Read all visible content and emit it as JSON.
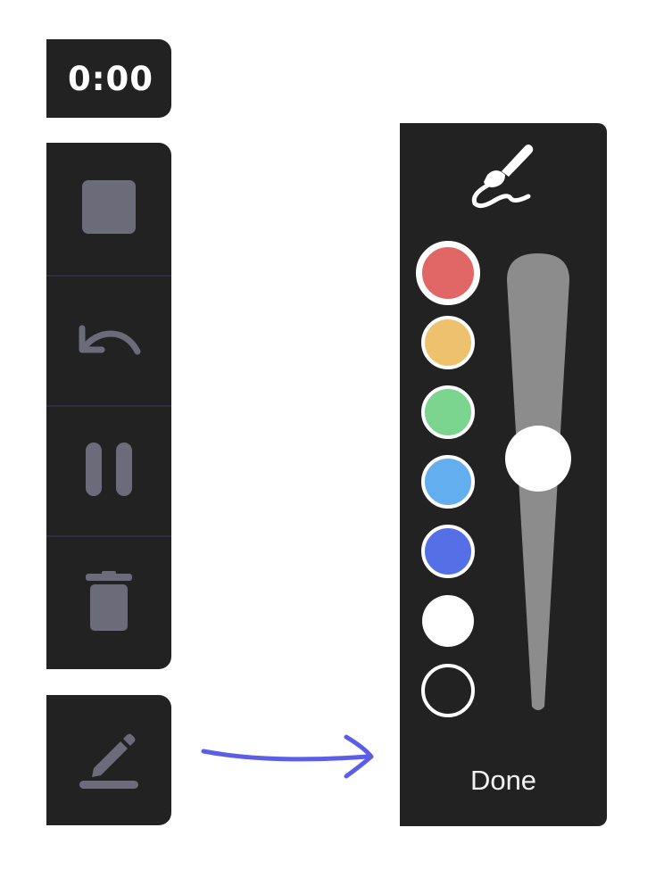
{
  "timer": {
    "value": "0:00"
  },
  "controls": {
    "stop_icon": "stop-square-icon",
    "undo_icon": "undo-arrow-icon",
    "pause_icon": "pause-icon",
    "delete_icon": "trash-icon"
  },
  "pen": {
    "icon": "pen-draw-icon"
  },
  "palette": {
    "brush_icon": "brush-squiggle-icon",
    "swatches": [
      {
        "name": "red",
        "color": "#e06766",
        "selected": true
      },
      {
        "name": "orange",
        "color": "#eec26d"
      },
      {
        "name": "green",
        "color": "#7cd58e"
      },
      {
        "name": "light-blue",
        "color": "#62aeef"
      },
      {
        "name": "blue",
        "color": "#5570e6"
      },
      {
        "name": "white",
        "color": "#ffffff"
      },
      {
        "name": "black",
        "color": "#222222"
      }
    ],
    "brush_size_level": 0.57,
    "done_label": "Done"
  },
  "colors": {
    "panel_bg": "#222222",
    "icon_gray": "#6b6b7a",
    "arrow": "#5b5fe8",
    "track": "#8c8c8c"
  }
}
